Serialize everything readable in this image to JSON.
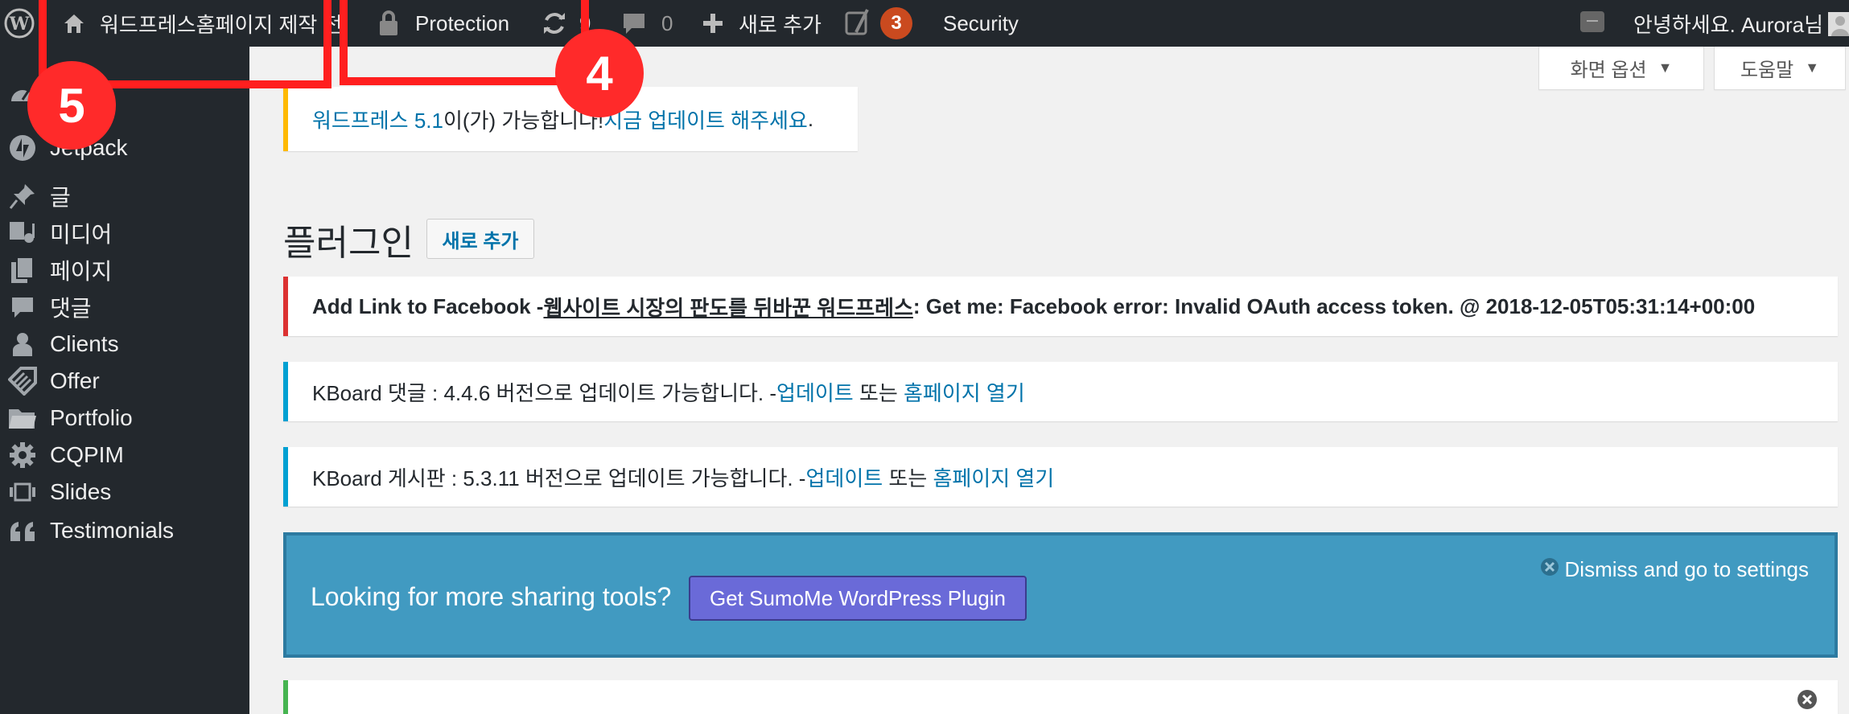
{
  "adminbar": {
    "site_name": "워드프레스홈페이지 제작 전",
    "protection": "Protection",
    "updates_count": "9",
    "comments_count": "0",
    "new_label": "새로 추가",
    "yoast_badge": "3",
    "security": "Security",
    "greeting": "안녕하세요. Aurora님"
  },
  "screen_options": {
    "screen_label": "화면 옵션",
    "help_label": "도움말"
  },
  "sidebar": {
    "items": [
      {
        "label": "Jetpack",
        "icon": "jetpack-icon"
      },
      {
        "label": "글",
        "icon": "pin-icon"
      },
      {
        "label": "미디어",
        "icon": "media-icon"
      },
      {
        "label": "페이지",
        "icon": "page-icon"
      },
      {
        "label": "댓글",
        "icon": "comment-icon"
      },
      {
        "label": "Clients",
        "icon": "user-icon"
      },
      {
        "label": "Offer",
        "icon": "tag-icon"
      },
      {
        "label": "Portfolio",
        "icon": "folder-icon"
      },
      {
        "label": "CQPIM",
        "icon": "gear-icon"
      },
      {
        "label": "Slides",
        "icon": "slides-icon"
      },
      {
        "label": "Testimonials",
        "icon": "quote-icon"
      }
    ]
  },
  "update_notice": {
    "version_link": "워드프레스 5.1",
    "text_middle": "이(가) 가능합니다! ",
    "update_link": "지금 업데이트 해주세요",
    "text_end": "."
  },
  "page": {
    "title": "플러그인",
    "add_new": "새로 추가"
  },
  "fb_error": {
    "prefix": "Add Link to Facebook - ",
    "link": "웹사이트 시장의 판도를 뒤바꾼 워드프레스",
    "suffix": ": Get me: Facebook error: Invalid OAuth access token. @ 2018-12-05T05:31:14+00:00"
  },
  "kboard_comment": {
    "text": "KBoard 댓글 : 4.4.6 버전으로 업데이트 가능합니다. - ",
    "update_link": "업데이트",
    "or_text": " 또는 ",
    "home_link": "홈페이지 열기"
  },
  "kboard_board": {
    "text": "KBoard 게시판 : 5.3.11 버전으로 업데이트 가능합니다. - ",
    "update_link": "업데이트",
    "or_text": " 또는 ",
    "home_link": "홈페이지 열기"
  },
  "sumo": {
    "title": "Looking for more sharing tools?",
    "button": "Get SumoMe WordPress Plugin",
    "dismiss": "Dismiss and go to settings"
  },
  "annotations": {
    "five": "5",
    "four": "4"
  },
  "colors": {
    "annotation_red": "#ff1f1f",
    "admin_bar": "#23282d",
    "link_blue": "#0073aa",
    "notice_error": "#dc3232",
    "notice_info": "#00a0d2",
    "notice_warning": "#ffb900",
    "sumo_bg": "#419ac1"
  }
}
